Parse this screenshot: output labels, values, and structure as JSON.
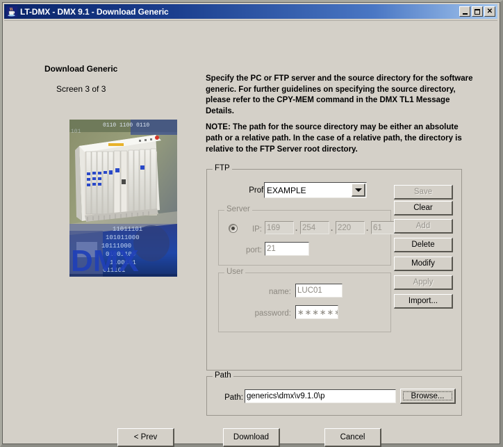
{
  "window": {
    "title": "LT-DMX - DMX 9.1 - Download Generic",
    "icon": "java-coffee-cup-icon",
    "controls": {
      "minimize": "–",
      "maximize": "□",
      "close": "✕"
    }
  },
  "left": {
    "heading": "Download Generic",
    "screen_of": "Screen 3 of 3",
    "image_alt": "DMX telecom equipment shelf photo"
  },
  "instructions": {
    "paragraph1": "Specify the PC or FTP server and the source directory for the software generic. For further guidelines on specifying the source directory, please refer to the CPY-MEM command in the DMX TL1 Message Details.",
    "paragraph2": "NOTE: The path for the source directory may be either an absolute path or a relative path. In the case of a relative path, the directory is relative to the FTP Server root directory."
  },
  "ftp": {
    "group_title": "FTP",
    "profile_label": "Profile:",
    "profile_value": "EXAMPLE",
    "profile_options": [
      "EXAMPLE"
    ],
    "server": {
      "group_title": "Server",
      "ip_label": "IP:",
      "ip_octets": [
        "169",
        "254",
        "220",
        "61"
      ],
      "separator": ".",
      "port_label": "port:",
      "port_value": "21",
      "radio_selected": true
    },
    "user": {
      "group_title": "User",
      "name_label": "name:",
      "name_value": "LUC01",
      "password_label": "password:",
      "password_value": "∗∗∗∗∗∗"
    },
    "buttons": [
      {
        "label": "Save",
        "enabled": false
      },
      {
        "label": "Clear",
        "enabled": true
      },
      {
        "label": "Add",
        "enabled": false
      },
      {
        "label": "Delete",
        "enabled": true
      },
      {
        "label": "Modify",
        "enabled": true
      },
      {
        "label": "Apply",
        "enabled": false
      },
      {
        "label": "Import...",
        "enabled": true
      }
    ]
  },
  "path": {
    "group_title": "Path",
    "label": "Path:",
    "value": "generics\\dmx\\v9.1.0\\p",
    "browse_label": "Browse...",
    "browse_focused": true
  },
  "footer": {
    "prev_label": "< Prev",
    "download_label": "Download",
    "cancel_label": "Cancel"
  },
  "colors": {
    "window_face": "#d4d0c8",
    "titlebar_start": "#0a246a",
    "titlebar_end": "#a6c8ef",
    "title_text": "#ffffff",
    "disabled_text": "#97948d"
  }
}
